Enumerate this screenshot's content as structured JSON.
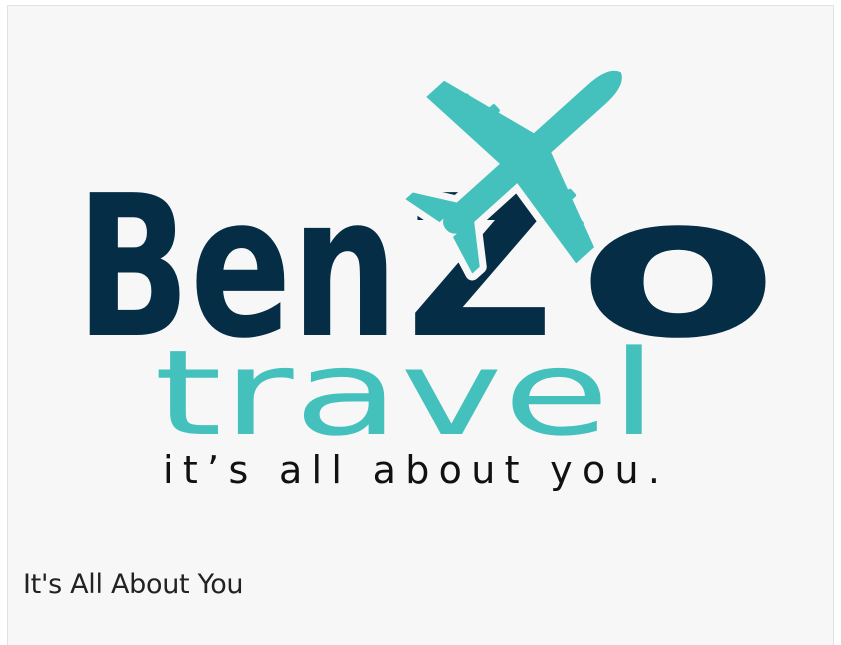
{
  "logo": {
    "brand_part1": "Ben",
    "brand_z": "Z",
    "brand_o": "o",
    "subbrand": "travel",
    "tagline": "it’s all about you.",
    "colors": {
      "navy": "#062d46",
      "teal": "#45c1bd"
    },
    "icon": "airplane-icon"
  },
  "caption": "It's All About You"
}
